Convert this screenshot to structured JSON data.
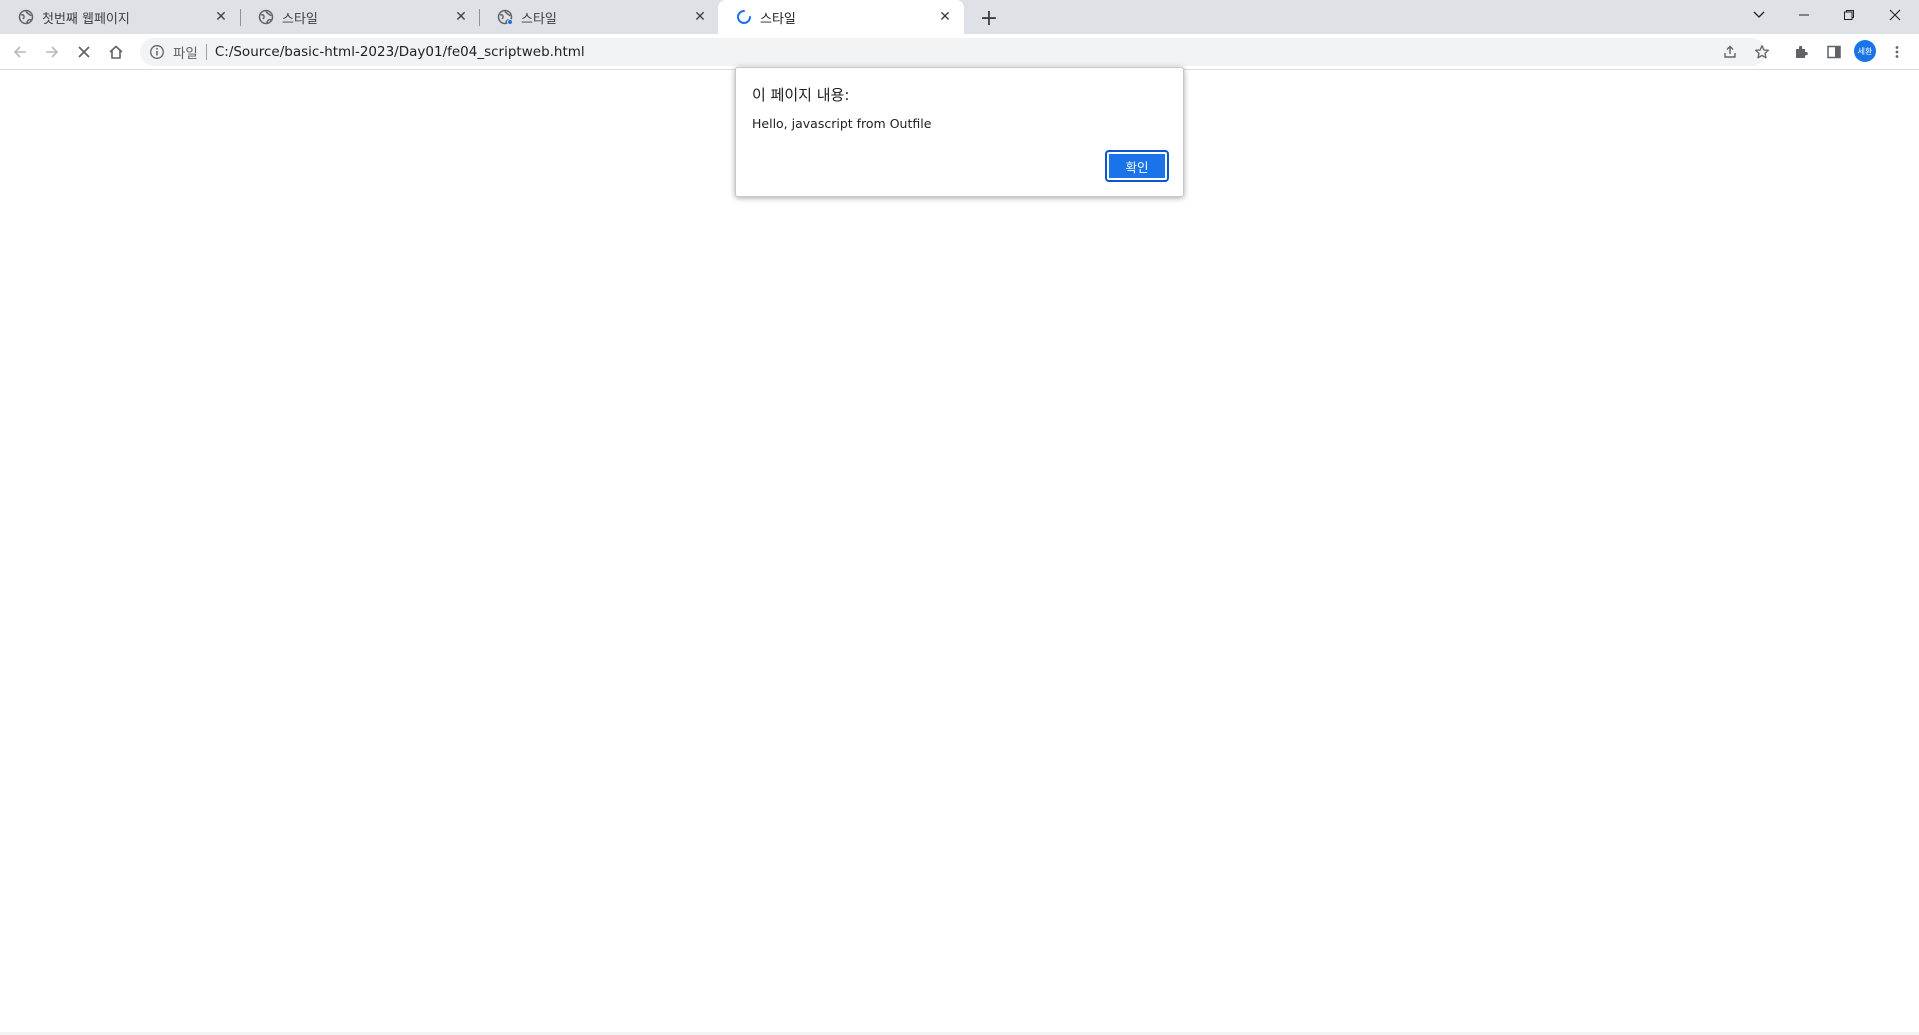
{
  "browser": {
    "tabs": [
      {
        "title": "첫번째 웹페이지",
        "icon": "globe-icon"
      },
      {
        "title": "스타일",
        "icon": "globe-icon"
      },
      {
        "title": "스타일",
        "icon": "globe-icon"
      },
      {
        "title": "스타일",
        "icon": "loading-spinner-icon"
      }
    ],
    "close_glyph": "✕",
    "new_tab_glyph": "+"
  },
  "address_bar": {
    "scheme_label": "파일",
    "url": "C:/Source/basic-html-2023/Day01/fe04_scriptweb.html"
  },
  "profile": {
    "initials": "세환"
  },
  "dialog": {
    "title": "이 페이지 내용:",
    "message": "Hello, javascript from Outfile",
    "ok_label": "확인"
  },
  "colors": {
    "accent": "#1a73e8",
    "tabstrip_bg": "#dee1e6",
    "omnibox_bg": "#f1f3f4"
  }
}
